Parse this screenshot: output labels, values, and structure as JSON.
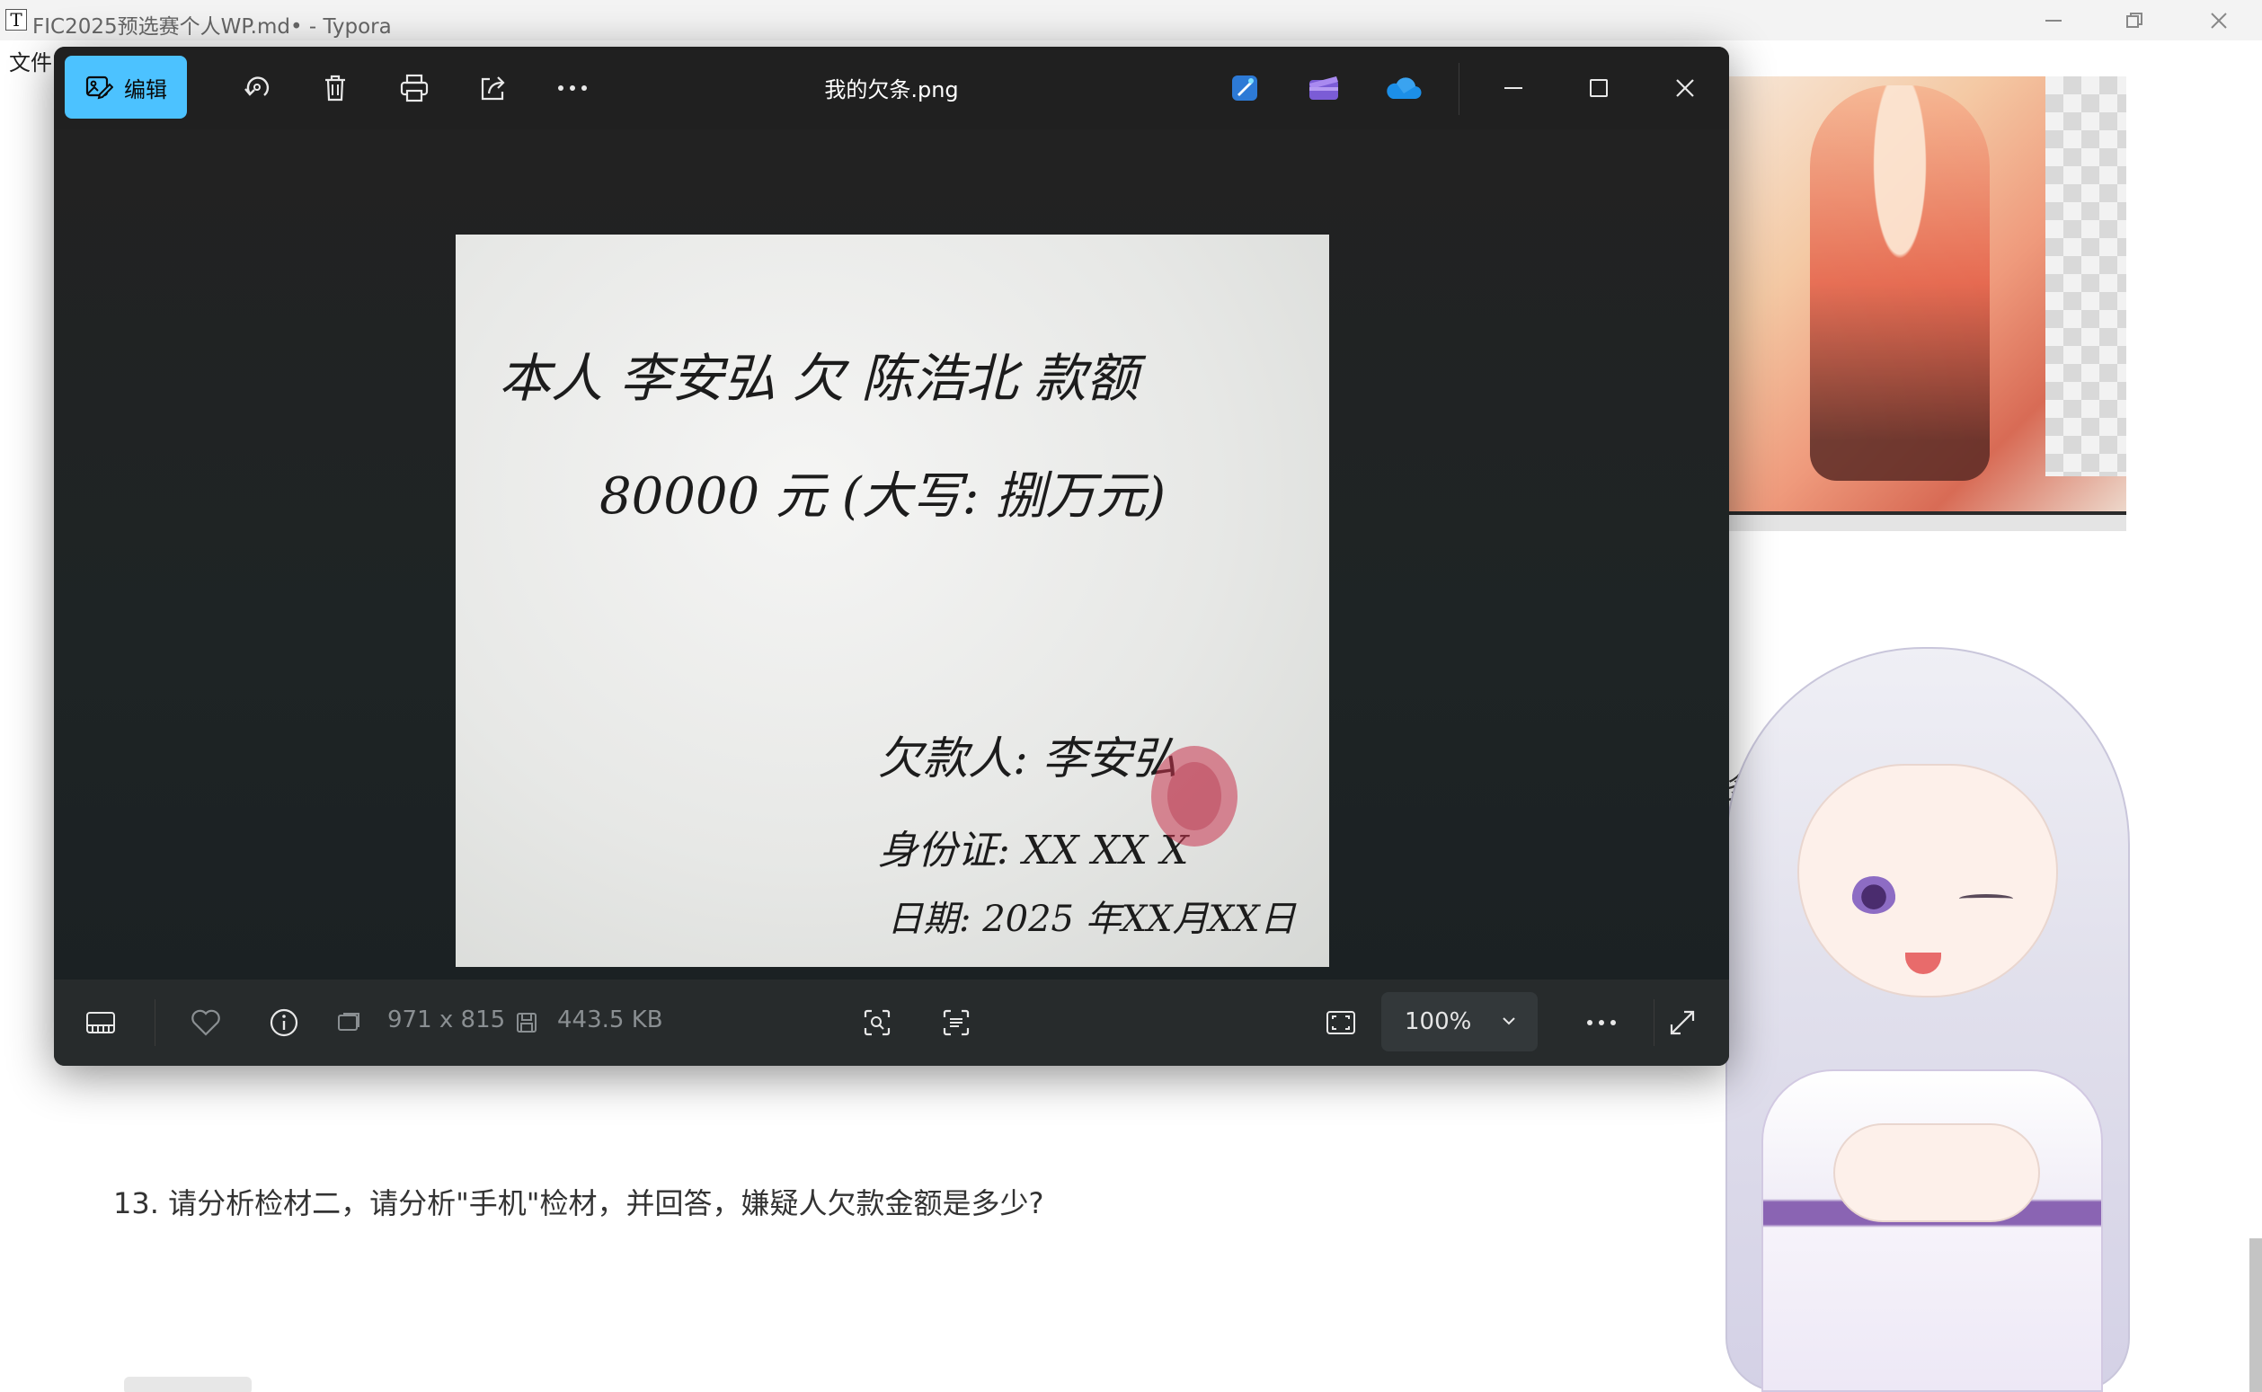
{
  "typora": {
    "window_title": "FIC2025预选赛个人WP.md• - Typora",
    "logo": "T",
    "menu_file": "文件",
    "partial_text": "多少?",
    "question": "13. 请分析检材二，请分析\"手机\"检材，并回答，嫌疑人欠款金额是多少?",
    "controls": [
      "minimize-icon",
      "restore-icon",
      "close-icon"
    ]
  },
  "viewer": {
    "file_name": "我的欠条.png",
    "edit_label": "编辑",
    "toolbar_icons": [
      "rotate-icon",
      "delete-icon",
      "print-icon",
      "share-icon",
      "more-icon"
    ],
    "app_icons": [
      "designer-icon",
      "clipchamp-icon",
      "onedrive-icon"
    ],
    "window_controls": [
      "minimize-icon",
      "maximize-icon",
      "close-icon"
    ],
    "status": {
      "dimensions": "971 x 815",
      "file_size": "443.5 KB",
      "zoom": "100%"
    },
    "bottom_icons": [
      "filmstrip-icon",
      "favorite-icon",
      "info-icon",
      "visual-search-icon",
      "text-scan-icon",
      "fit-window-icon",
      "more-icon",
      "fullscreen-icon"
    ]
  },
  "note": {
    "line1": "本人 李安弘 欠 陈浩北 款额",
    "line2": "80000 元 (大写: 捌万元)",
    "debtor": "欠款人: 李安弘",
    "id": "身份证: XX XX X",
    "date": "日期: 2025 年XX月XX日"
  },
  "colors": {
    "accent": "#4cc2ff",
    "viewer_bg": "#1d2021",
    "fingerprint": "#c8344e"
  }
}
